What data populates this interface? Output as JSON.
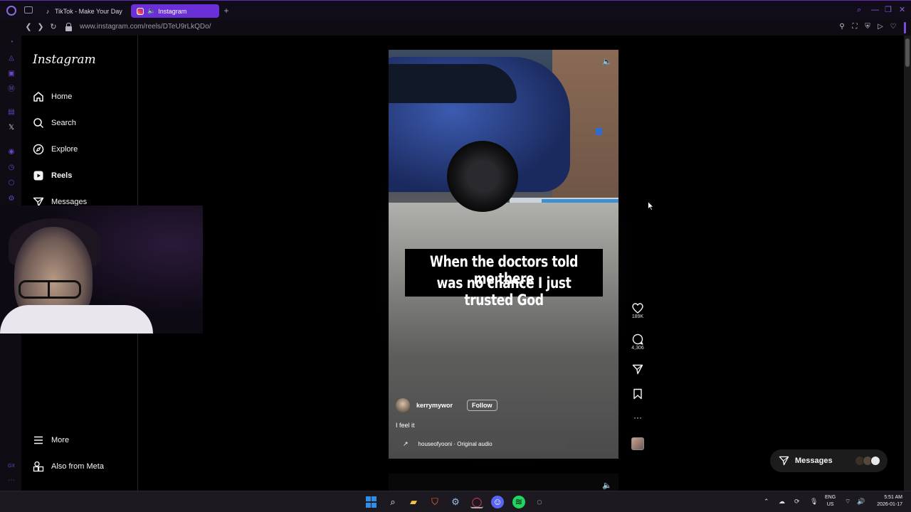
{
  "browser": {
    "tabs": [
      {
        "label": "TikTok - Make Your Day",
        "active": false
      },
      {
        "label": "Instagram",
        "active": true
      }
    ],
    "url": "www.instagram.com/reels/DTeU9rLkQDo/"
  },
  "instagram": {
    "logo": "Instagram",
    "nav": {
      "home": "Home",
      "search": "Search",
      "explore": "Explore",
      "reels": "Reels",
      "messages": "Messages",
      "more": "More",
      "also_from_meta": "Also from Meta"
    },
    "reel": {
      "caption_line1": "When the doctors told me there",
      "caption_line2": "was no chance I just trusted God",
      "username": "kerrymywor",
      "follow_label": "Follow",
      "description": "I feel it",
      "audio": "houseofyooni · Original audio",
      "likes": "189K",
      "comments": "4,306"
    },
    "messages_pill": "Messages"
  },
  "taskbar": {
    "lang_line1": "ENG",
    "lang_line2": "US",
    "time": "5:51 AM",
    "date": "2026-01-17"
  },
  "colors": {
    "opera_accent": "#6a2fd6",
    "page_bg": "#000000",
    "windows_blue": "#2f8fe8"
  }
}
